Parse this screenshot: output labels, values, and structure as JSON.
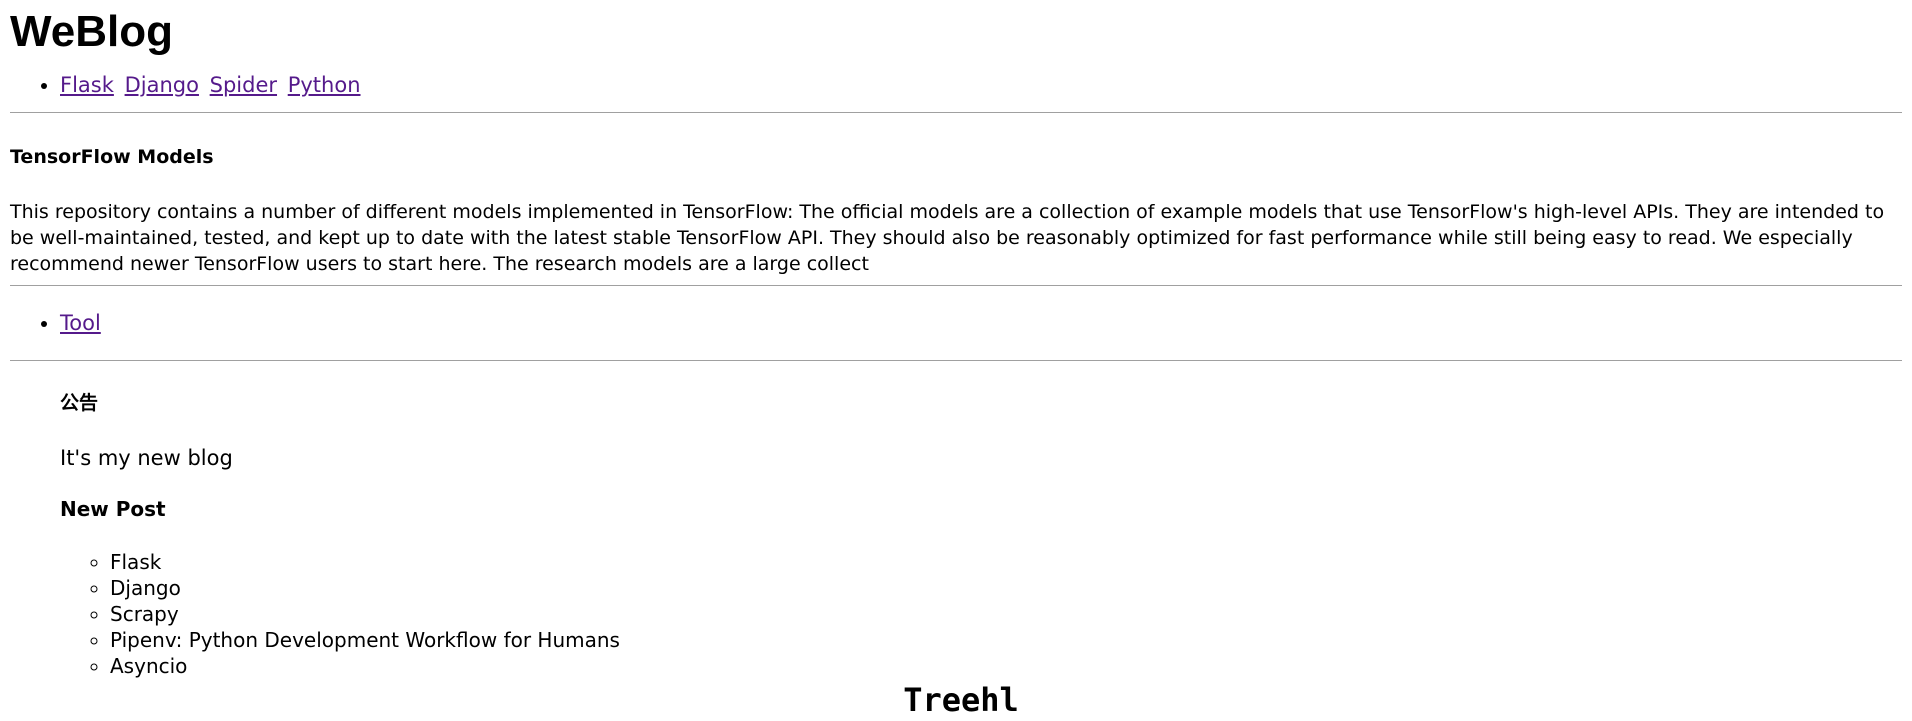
{
  "site": {
    "title": "WeBlog"
  },
  "nav": {
    "links": [
      "Flask",
      "Django",
      "Spider",
      "Python"
    ]
  },
  "post": {
    "title": "TensorFlow Models",
    "body": "This repository contains a number of different models implemented in TensorFlow: The official models are a collection of example models that use TensorFlow's high-level APIs. They are intended to be well-maintained, tested, and kept up to date with the latest stable TensorFlow API. They should also be reasonably optimized for fast performance while still being easy to read. We especially recommend newer TensorFlow users to start here. The research models are a large collect"
  },
  "tools": {
    "links": [
      "Tool"
    ]
  },
  "notice": {
    "title": "公告",
    "text": "It's my new blog"
  },
  "new_posts": {
    "title": "New Post",
    "items": [
      "Flask",
      "Django",
      "Scrapy",
      "Pipenv: Python Development Workflow for Humans",
      "Asyncio"
    ]
  },
  "footer": {
    "text": "Treehl"
  },
  "colors": {
    "link": "#551a8b",
    "rule": "#a0a0a0",
    "text": "#000000"
  }
}
